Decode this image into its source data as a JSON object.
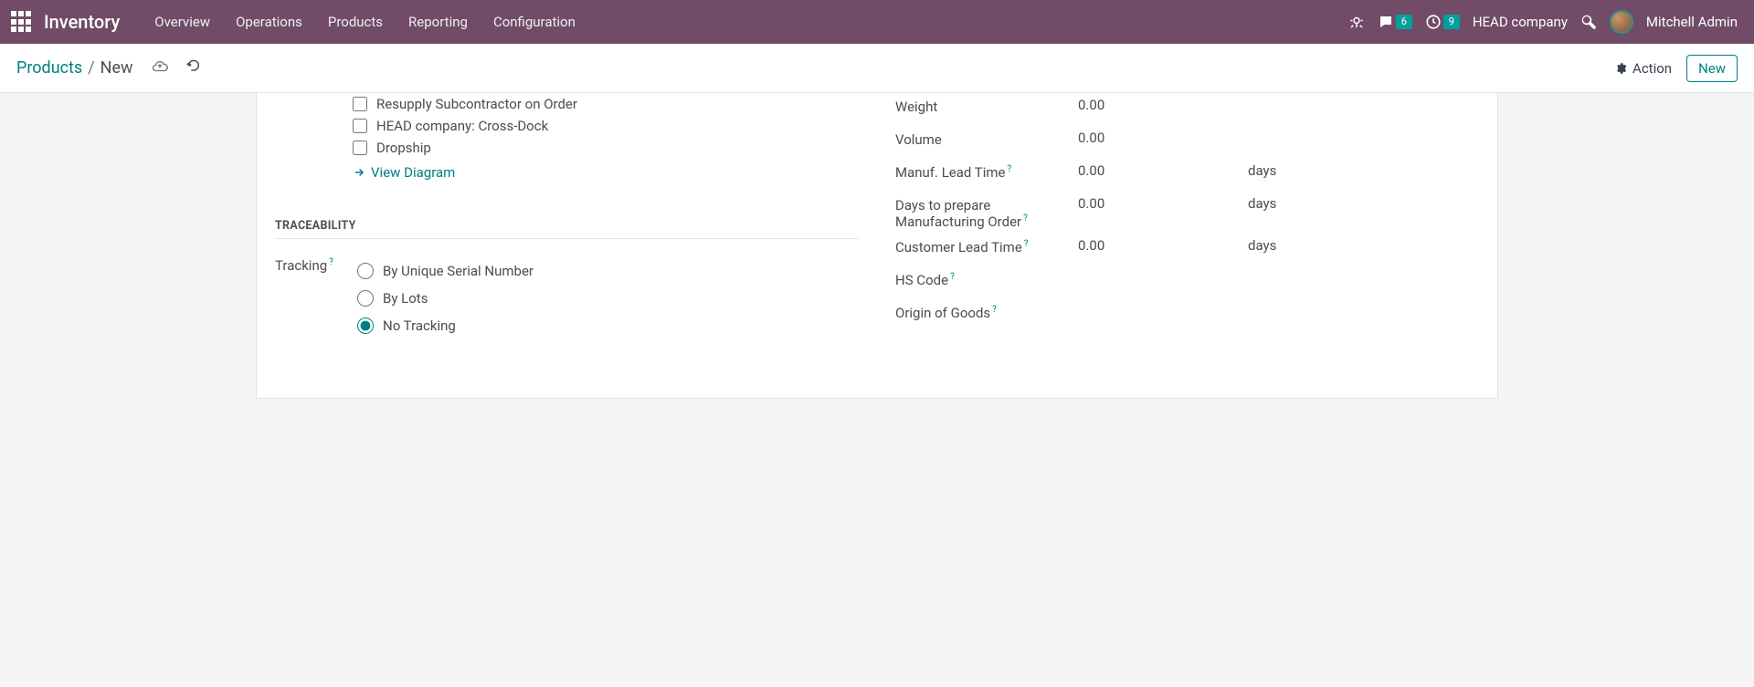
{
  "topbar": {
    "app_name": "Inventory",
    "nav": [
      "Overview",
      "Operations",
      "Products",
      "Reporting",
      "Configuration"
    ],
    "messages_badge": "6",
    "activities_badge": "9",
    "company": "HEAD company",
    "user": "Mitchell Admin"
  },
  "breadcrumb": {
    "parent": "Products",
    "current": "New",
    "action_label": "Action",
    "new_label": "New"
  },
  "routes": {
    "items": [
      {
        "label": "Resupply Subcontractor on Order",
        "checked": false
      },
      {
        "label": "HEAD company: Cross-Dock",
        "checked": false
      },
      {
        "label": "Dropship",
        "checked": false
      }
    ],
    "view_diagram": "View Diagram"
  },
  "logistics": {
    "weight_label": "Weight",
    "weight_value": "0.00",
    "volume_label": "Volume",
    "volume_value": "0.00",
    "manuf_lead_label": "Manuf. Lead Time",
    "manuf_lead_value": "0.00",
    "days_prepare_label": "Days to prepare Manufacturing Order",
    "days_prepare_value": "0.00",
    "cust_lead_label": "Customer Lead Time",
    "cust_lead_value": "0.00",
    "days_unit": "days",
    "hs_code_label": "HS Code",
    "origin_label": "Origin of Goods"
  },
  "traceability": {
    "section": "TRACEABILITY",
    "field_label": "Tracking",
    "options": [
      {
        "label": "By Unique Serial Number",
        "checked": false
      },
      {
        "label": "By Lots",
        "checked": false
      },
      {
        "label": "No Tracking",
        "checked": true
      }
    ]
  }
}
